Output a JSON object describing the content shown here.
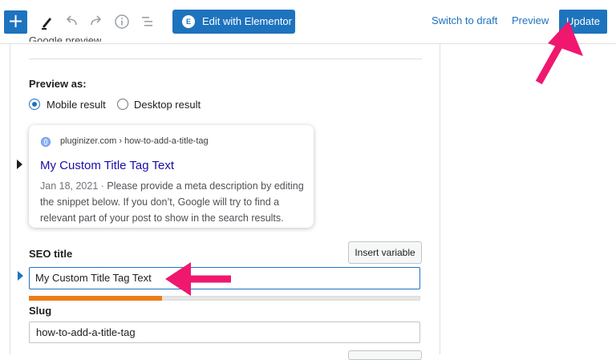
{
  "toolbar": {
    "add_icon": "plus-icon",
    "tools_icon": "pen-icon",
    "undo_icon": "undo-icon",
    "redo_icon": "redo-icon",
    "details_icon": "info-icon",
    "outline_icon": "list-view-icon",
    "elementor_badge": "E",
    "elementor_label": "Edit with Elementor",
    "switch_to_draft": "Switch to draft",
    "preview": "Preview",
    "update": "Update"
  },
  "section": {
    "preview_as_label": "Preview as:",
    "mobile_result_label": "Mobile result",
    "desktop_result_label": "Desktop result",
    "selected_mode": "Mobile result"
  },
  "snippet": {
    "url": "pluginizer.com › how-to-add-a-title-tag",
    "title": "My Custom Title Tag Text",
    "date": "Jan 18, 2021",
    "separator": " · ",
    "description": "Please provide a meta description by editing the snippet below. If you don’t, Google will try to find a relevant part of your post to show in the search results."
  },
  "seo": {
    "title_label": "SEO title",
    "insert_variable": "Insert variable",
    "title_value": "My Custom Title Tag Text",
    "title_progress": 0.34,
    "progress_color": "#ee7c1b",
    "slug_label": "Slug",
    "slug_value": "how-to-add-a-title-tag"
  },
  "colors": {
    "accent": "#1e73be",
    "annotation_arrow": "#f0176e"
  }
}
